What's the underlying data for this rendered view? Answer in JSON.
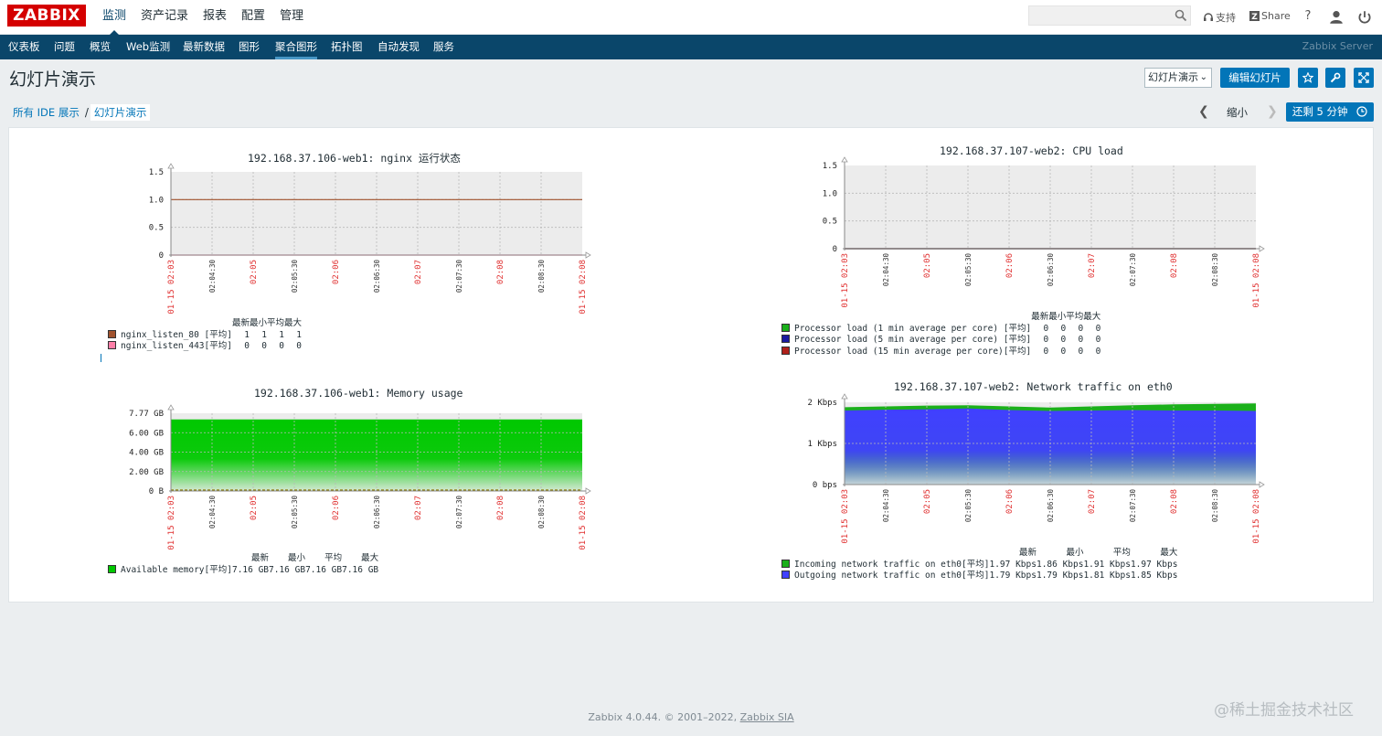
{
  "header": {
    "logo": "ZABBIX",
    "menu": [
      "监测",
      "资产记录",
      "报表",
      "配置",
      "管理"
    ],
    "support": "支持",
    "share": "Share",
    "help": "?"
  },
  "subnav": {
    "items": [
      "仪表板",
      "问题",
      "概览",
      "Web监测",
      "最新数据",
      "图形",
      "聚合图形",
      "拓扑图",
      "自动发现",
      "服务"
    ],
    "server": "Zabbix Server"
  },
  "page": {
    "title": "幻灯片演示",
    "select_value": "幻灯片演示",
    "edit_button": "编辑幻灯片",
    "breadcrumb_all": "所有 IDE 展示",
    "breadcrumb_sep": "/",
    "breadcrumb_current": "幻灯片演示",
    "zoom_label": "缩小",
    "refresh_button": "还剩 5 分钟"
  },
  "legend_headers": [
    "最新",
    "最小",
    "平均",
    "最大"
  ],
  "graphs": [
    {
      "title": "192.168.37.106-web1: nginx 运行状态",
      "y_ticks": [
        "1.5",
        "1.0",
        "0.5",
        "0"
      ],
      "x_ticks": [
        "01-15 02:03",
        "02:04:30",
        "02:05",
        "02:05:30",
        "02:06",
        "02:06:30",
        "02:07",
        "02:07:30",
        "02:08",
        "02:08:30",
        "01-15 02:08"
      ],
      "legend": [
        {
          "name": "nginx_listen_80",
          "func": "[平均]",
          "last": "1",
          "min": "1",
          "avg": "1",
          "max": "1",
          "color": "#a0522d"
        },
        {
          "name": "nginx_listen_443",
          "func": "[平均]",
          "last": "0",
          "min": "0",
          "avg": "0",
          "max": "0",
          "color": "#ff7fa8"
        }
      ]
    },
    {
      "title": "192.168.37.107-web2: CPU load",
      "y_ticks": [
        "1.5",
        "1.0",
        "0.5",
        "0"
      ],
      "x_ticks": [
        "01-15 02:03",
        "02:04:30",
        "02:05",
        "02:05:30",
        "02:06",
        "02:06:30",
        "02:07",
        "02:07:30",
        "02:08",
        "02:08:30",
        "01-15 02:08"
      ],
      "legend": [
        {
          "name": "Processor load (1 min average per core)",
          "func": "[平均]",
          "last": "0",
          "min": "0",
          "avg": "0",
          "max": "0",
          "color": "#1ab01a"
        },
        {
          "name": "Processor load (5 min average per core)",
          "func": "[平均]",
          "last": "0",
          "min": "0",
          "avg": "0",
          "max": "0",
          "color": "#1a1aa0"
        },
        {
          "name": "Processor load (15 min average per core)",
          "func": "[平均]",
          "last": "0",
          "min": "0",
          "avg": "0",
          "max": "0",
          "color": "#b0201a"
        }
      ]
    },
    {
      "title": "192.168.37.106-web1: Memory usage",
      "y_ticks": [
        "7.77 GB",
        "6.00 GB",
        "4.00 GB",
        "2.00 GB",
        "0 B"
      ],
      "x_ticks": [
        "01-15 02:03",
        "02:04:30",
        "02:05",
        "02:05:30",
        "02:06",
        "02:06:30",
        "02:07",
        "02:07:30",
        "02:08",
        "02:08:30",
        "01-15 02:08"
      ],
      "legend": [
        {
          "name": "Available memory",
          "func": "[平均]",
          "last": "7.16 GB",
          "min": "7.16 GB",
          "avg": "7.16 GB",
          "max": "7.16 GB",
          "color": "#00c800"
        }
      ]
    },
    {
      "title": "192.168.37.107-web2: Network traffic on eth0",
      "y_ticks": [
        "2 Kbps",
        "1 Kbps",
        "0 bps"
      ],
      "x_ticks": [
        "01-15 02:03",
        "02:04:30",
        "02:05",
        "02:05:30",
        "02:06",
        "02:06:30",
        "02:07",
        "02:07:30",
        "02:08",
        "02:08:30",
        "01-15 02:08"
      ],
      "legend": [
        {
          "name": "Incoming network traffic on eth0",
          "func": "[平均]",
          "last": "1.97 Kbps",
          "min": "1.86 Kbps",
          "avg": "1.91 Kbps",
          "max": "1.97 Kbps",
          "color": "#1ab01a"
        },
        {
          "name": "Outgoing network traffic on eth0",
          "func": "[平均]",
          "last": "1.79 Kbps",
          "min": "1.79 Kbps",
          "avg": "1.81 Kbps",
          "max": "1.85 Kbps",
          "color": "#4040ff"
        }
      ]
    }
  ],
  "chart_data": [
    {
      "type": "line",
      "title": "192.168.37.106-web1: nginx 运行状态",
      "ylim": [
        0,
        1.5
      ],
      "series": [
        {
          "name": "nginx_listen_80",
          "values": [
            1,
            1,
            1,
            1,
            1,
            1,
            1,
            1,
            1,
            1,
            1
          ]
        },
        {
          "name": "nginx_listen_443",
          "values": [
            0,
            0,
            0,
            0,
            0,
            0,
            0,
            0,
            0,
            0,
            0
          ]
        }
      ]
    },
    {
      "type": "line",
      "title": "192.168.37.107-web2: CPU load",
      "ylim": [
        0,
        1.5
      ],
      "series": [
        {
          "name": "Processor load (1 min average per core)",
          "values": [
            0,
            0,
            0,
            0,
            0,
            0,
            0,
            0,
            0,
            0,
            0
          ]
        },
        {
          "name": "Processor load (5 min average per core)",
          "values": [
            0,
            0,
            0,
            0,
            0,
            0,
            0,
            0,
            0,
            0,
            0
          ]
        },
        {
          "name": "Processor load (15 min average per core)",
          "values": [
            0,
            0,
            0,
            0,
            0,
            0,
            0,
            0,
            0,
            0,
            0
          ]
        }
      ]
    },
    {
      "type": "area",
      "title": "192.168.37.106-web1: Memory usage",
      "ylim": [
        0,
        7.77
      ],
      "series": [
        {
          "name": "Available memory",
          "values": [
            7.16,
            7.16,
            7.16,
            7.16,
            7.16,
            7.16,
            7.16,
            7.16,
            7.16,
            7.16,
            7.16
          ]
        }
      ]
    },
    {
      "type": "area",
      "title": "192.168.37.107-web2: Network traffic on eth0",
      "ylim": [
        0,
        2
      ],
      "series": [
        {
          "name": "Outgoing network traffic on eth0",
          "values": [
            1.8,
            1.82,
            1.83,
            1.85,
            1.81,
            1.79,
            1.8,
            1.81,
            1.8,
            1.8,
            1.79
          ]
        },
        {
          "name": "Incoming network traffic on eth0",
          "values": [
            1.88,
            1.9,
            1.92,
            1.93,
            1.9,
            1.87,
            1.9,
            1.93,
            1.95,
            1.96,
            1.97
          ]
        }
      ]
    }
  ],
  "footer": {
    "text": "Zabbix 4.0.44. © 2001–2022, ",
    "link": "Zabbix SIA"
  },
  "watermark": "@稀土掘金技术社区"
}
